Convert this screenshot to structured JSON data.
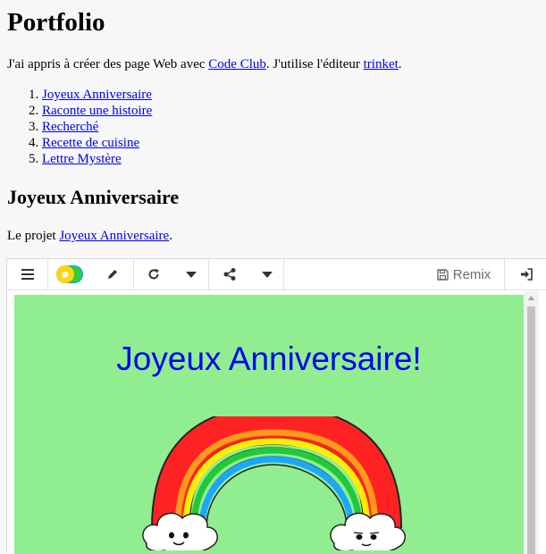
{
  "header": {
    "title": "Portfolio"
  },
  "intro": {
    "before": "J'ai appris à créer des page Web avec ",
    "link1": "Code Club",
    "middle": ". J'utilise l'éditeur ",
    "link2": "trinket",
    "after": "."
  },
  "projects": [
    {
      "label": "Joyeux Anniversaire"
    },
    {
      "label": "Raconte une histoire"
    },
    {
      "label": "Recherché"
    },
    {
      "label": "Recette de cuisine"
    },
    {
      "label": "Lettre Mystère"
    }
  ],
  "section": {
    "heading": "Joyeux Anniversaire",
    "project_before": "Le projet ",
    "project_link": "Joyeux Anniversaire",
    "project_after": "."
  },
  "trinket": {
    "toolbar": {
      "remix_label": "Remix",
      "icons": [
        "menu-icon",
        "run-toggle-icon",
        "pencil-icon",
        "reset-icon",
        "chevron-down-icon",
        "share-icon",
        "chevron-down-icon",
        "floppy-disk-icon",
        "sign-in-icon"
      ]
    },
    "output": {
      "title": "Joyeux Anniversaire!",
      "background": "#90ee90",
      "title_color": "#0000ee",
      "image": "rainbow-with-clouds"
    }
  },
  "colors": {
    "link": "#0000ee",
    "page_bg": "#f7f7f7"
  }
}
